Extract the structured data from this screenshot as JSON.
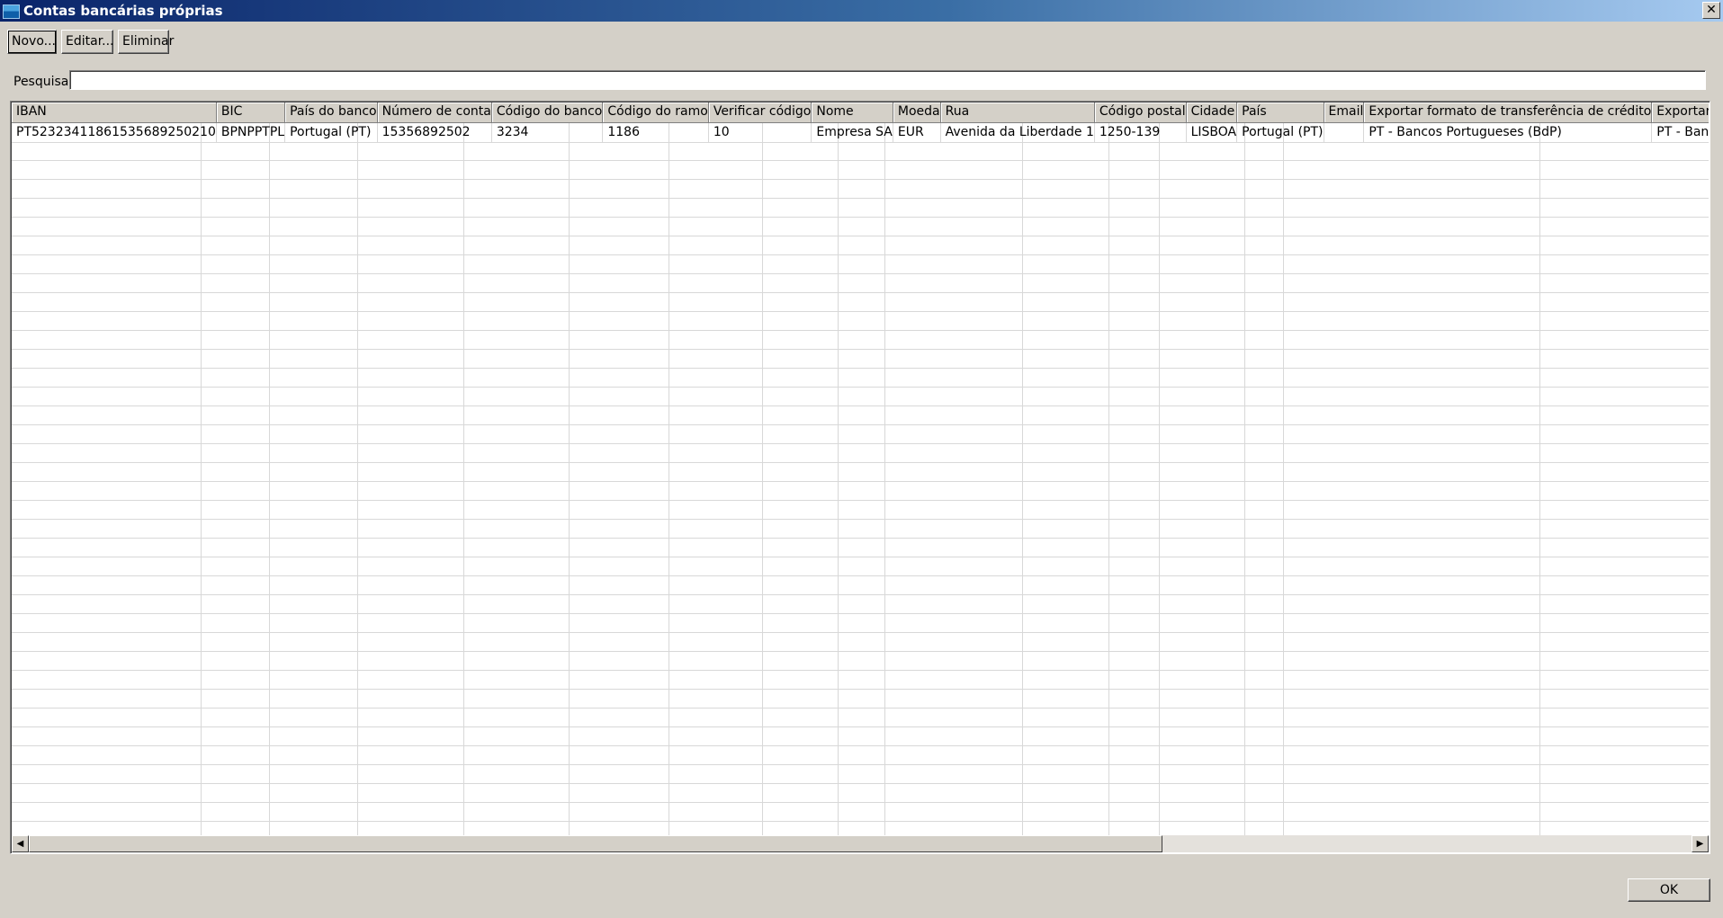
{
  "window": {
    "title": "Contas bancárias próprias",
    "close_label": "✕"
  },
  "toolbar": {
    "new_label": "Novo...",
    "edit_label": "Editar...",
    "delete_label": "Eliminar"
  },
  "search": {
    "label": "Pesquisa:",
    "value": ""
  },
  "table": {
    "columns": [
      "IBAN",
      "BIC",
      "País do banco",
      "Número de conta",
      "Código do banco",
      "Código do ramo",
      "Verificar código",
      "Nome",
      "Moeda",
      "Rua",
      "Código postal",
      "Cidade",
      "País",
      "Email",
      "Exportar formato de transferência de crédito",
      "Exportar formato de débito di"
    ],
    "rows": [
      [
        "PT52323411861535689250210",
        "BPNPPTPL",
        "Portugal (PT)",
        "15356892502",
        "3234",
        "1186",
        "10",
        "Empresa SA",
        "EUR",
        "Avenida da Liberdade 1",
        "1250-139",
        "LISBOA",
        "Portugal (PT)",
        "",
        "PT - Bancos Portugueses (BdP)",
        "PT - Bancos Portugueses (BdP"
      ]
    ]
  },
  "scrollbar": {
    "left_arrow": "◀",
    "right_arrow": "▶"
  },
  "footer": {
    "ok_label": "OK"
  }
}
